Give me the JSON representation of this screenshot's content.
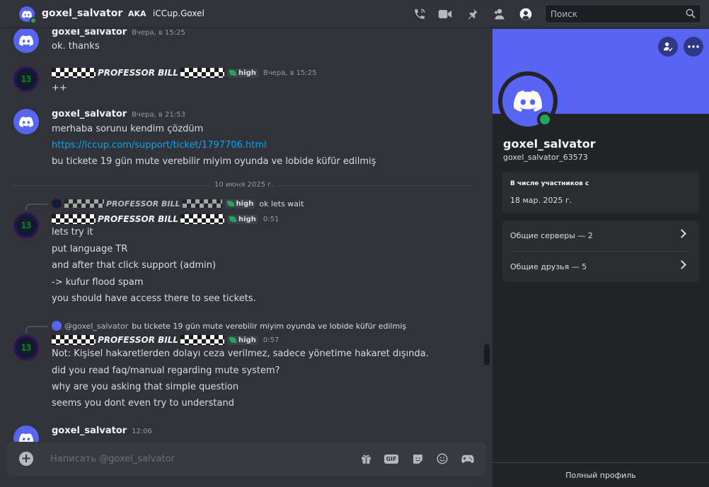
{
  "header": {
    "dm_name": "goxel_salvator",
    "aka_label": "AKA",
    "aka_name": "iCCup.Goxel",
    "search_placeholder": "Поиск",
    "icons": [
      "voice-call-icon",
      "video-call-icon",
      "pin-icon",
      "add-friends-icon",
      "profile-toggle-icon",
      "search-icon"
    ]
  },
  "messages": [
    {
      "author": "goxel_salvator",
      "time": "Вчера, в 15:25",
      "lines": [
        "ok. thanks"
      ]
    },
    {
      "author": "PROFESSOR BILL",
      "badge": "high",
      "time": "Вчера, в 15:25",
      "lines": [
        "++"
      ]
    },
    {
      "author": "goxel_salvator",
      "time": "Вчера, в 21:53",
      "lines": [
        "merhaba sorunu kendim çözdüm",
        "https://iccup.com/support/ticket/1797706.html",
        "bu tickete 19 gün mute verebilir miyim oyunda ve lobide küfür edilmiş"
      ]
    },
    {
      "reply_author": "PROFESSOR BILL",
      "reply_badge": "high",
      "reply_text": "ok lets wait",
      "author": "PROFESSOR BILL",
      "badge": "high",
      "time": "0:51",
      "lines": [
        "lets try it",
        "put language TR",
        "and after that click support (admin)",
        "-> kufur flood spam",
        "you should have access there to see tickets."
      ]
    },
    {
      "reply_author": "@goxel_salvator",
      "reply_text": "bu tickete 19 gün mute verebilir miyim oyunda ve lobide küfür edilmiş",
      "author": "PROFESSOR BILL",
      "badge": "high",
      "time": "0:57",
      "lines": [
        "Not: Kişisel hakaretlerden dolayı ceza verilmez, sadece yönetime hakaret dışında.",
        "did you read faq/manual regarding mute system?",
        "why are you asking that simple question",
        "seems you dont even try to understand"
      ]
    },
    {
      "author": "goxel_salvator",
      "time": "12:06",
      "lines": []
    }
  ],
  "date_divider": "10 июня 2025 г.",
  "composer": {
    "placeholder": "Написать @goxel_salvator",
    "gif_label": "GIF",
    "icons": [
      "add-attachment-icon",
      "gift-icon",
      "gif-icon",
      "sticker-icon",
      "emoji-icon",
      "activities-icon"
    ]
  },
  "profile": {
    "display_name": "goxel_salvator",
    "username": "goxel_salvator_63573",
    "member_since_label": "В числе участников с",
    "member_since": "18 мар. 2025 г.",
    "mutual_servers": "Общие серверы — 2",
    "mutual_friends": "Общие друзья — 5",
    "full_profile": "Полный профиль",
    "banner_color": "#5865f2",
    "status_color": "#23a55a"
  },
  "colors": {
    "accent": "#5865f2",
    "link": "#00a8fc",
    "online": "#23a55a"
  }
}
